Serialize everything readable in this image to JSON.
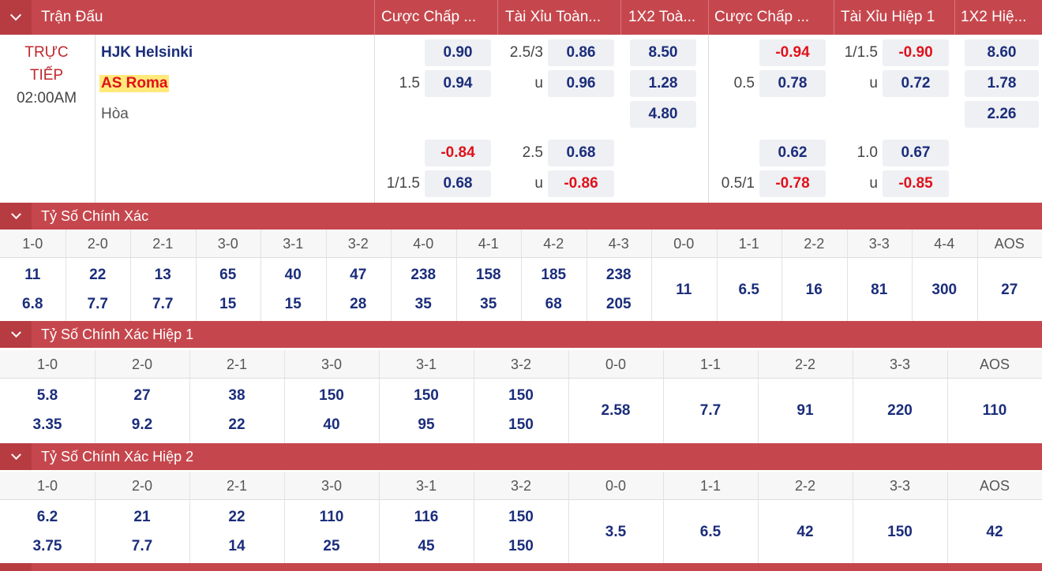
{
  "header": {
    "match_col": "Trận Đấu",
    "cols": [
      "Cược Chấp ...",
      "Tài Xỉu Toàn...",
      "1X2 Toà...",
      "Cược Chấp ...",
      "Tài Xỉu Hiệp 1",
      "1X2 Hiệ..."
    ]
  },
  "match": {
    "status_line1": "TRỰC",
    "status_line2": "TIẾP",
    "time": "02:00AM",
    "home": "HJK Helsinki",
    "away": "AS Roma",
    "draw": "Hòa"
  },
  "odds": {
    "ft_hcp": [
      {
        "line": "",
        "home": "0.90",
        "away": "0.94",
        "away_line": "1.5"
      },
      {
        "line": "",
        "home": "-0.84",
        "away": "0.68",
        "away_line": "1/1.5"
      }
    ],
    "ft_ou": [
      {
        "line": "2.5/3",
        "over": "0.86",
        "u": "u",
        "under": "0.96"
      },
      {
        "line": "2.5",
        "over": "0.68",
        "u": "u",
        "under": "-0.86"
      }
    ],
    "ft_1x2": [
      "8.50",
      "1.28",
      "4.80"
    ],
    "h1_hcp": [
      {
        "home": "-0.94",
        "away": "0.78",
        "away_line": "0.5"
      },
      {
        "home": "0.62",
        "away": "-0.78",
        "away_line": "0.5/1"
      }
    ],
    "h1_ou": [
      {
        "line": "1/1.5",
        "over": "-0.90",
        "u": "u",
        "under": "0.72"
      },
      {
        "line": "1.0",
        "over": "0.67",
        "u": "u",
        "under": "-0.85"
      }
    ],
    "h1_1x2": [
      "8.60",
      "1.78",
      "2.26"
    ]
  },
  "exact": {
    "title": "Tỷ Số Chính Xác",
    "headers": [
      "1-0",
      "2-0",
      "2-1",
      "3-0",
      "3-1",
      "3-2",
      "4-0",
      "4-1",
      "4-2",
      "4-3",
      "0-0",
      "1-1",
      "2-2",
      "3-3",
      "4-4",
      "AOS"
    ],
    "top": [
      "11",
      "22",
      "13",
      "65",
      "40",
      "47",
      "238",
      "158",
      "185",
      "238"
    ],
    "bottom": [
      "6.8",
      "7.7",
      "7.7",
      "15",
      "15",
      "28",
      "35",
      "35",
      "68",
      "205"
    ],
    "single": [
      "11",
      "6.5",
      "16",
      "81",
      "300",
      "27"
    ]
  },
  "exact_h1": {
    "title": "Tỷ Số Chính Xác Hiệp 1",
    "headers": [
      "1-0",
      "2-0",
      "2-1",
      "3-0",
      "3-1",
      "3-2",
      "0-0",
      "1-1",
      "2-2",
      "3-3",
      "AOS"
    ],
    "top": [
      "5.8",
      "27",
      "38",
      "150",
      "150",
      "150"
    ],
    "bottom": [
      "3.35",
      "9.2",
      "22",
      "40",
      "95",
      "150"
    ],
    "single": [
      "2.58",
      "7.7",
      "91",
      "220",
      "110"
    ]
  },
  "exact_h2": {
    "title": "Tỷ Số Chính Xác Hiệp 2",
    "headers": [
      "1-0",
      "2-0",
      "2-1",
      "3-0",
      "3-1",
      "3-2",
      "0-0",
      "1-1",
      "2-2",
      "3-3",
      "AOS"
    ],
    "top": [
      "6.2",
      "21",
      "22",
      "110",
      "116",
      "150"
    ],
    "bottom": [
      "3.75",
      "7.7",
      "14",
      "25",
      "45",
      "150"
    ],
    "single": [
      "3.5",
      "6.5",
      "42",
      "150",
      "42"
    ]
  }
}
